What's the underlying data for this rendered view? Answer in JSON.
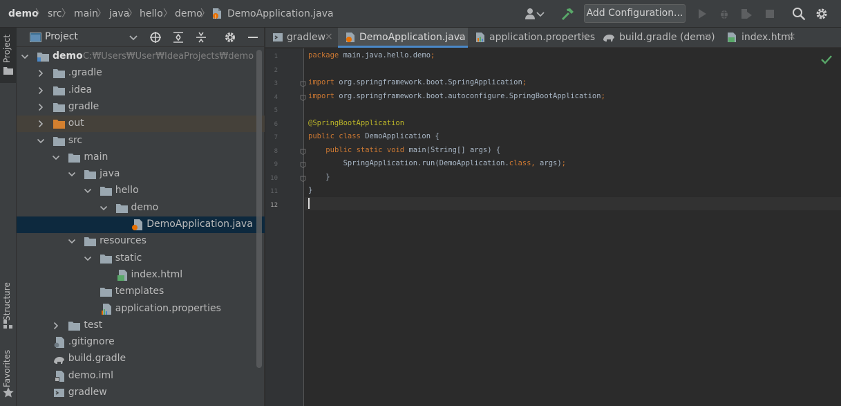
{
  "breadcrumb": {
    "items": [
      "demo",
      "src",
      "main",
      "java",
      "hello",
      "demo",
      "DemoApplication.java"
    ],
    "sep": "〉"
  },
  "toolbar": {
    "add_config_label": "Add Configuration...",
    "icons": [
      "user-icon",
      "chevron-down-icon",
      "hammer-icon",
      "run-icon",
      "debug-icon",
      "coverage-icon",
      "stop-icon",
      "search-icon",
      "gear-icon"
    ]
  },
  "left_stripe": {
    "project_label": "Project",
    "structure_label": "Structure",
    "favorites_label": "Favorites"
  },
  "project_panel": {
    "title": "Project",
    "tree": [
      {
        "label": "demo",
        "path": "C:\\Users\\User\\IdeaProjects\\demo",
        "depth": 0,
        "type": "module-folder",
        "expanded": true
      },
      {
        "label": ".gradle",
        "depth": 1,
        "type": "folder",
        "expanded": false
      },
      {
        "label": ".idea",
        "depth": 1,
        "type": "folder",
        "expanded": false
      },
      {
        "label": "gradle",
        "depth": 1,
        "type": "folder",
        "expanded": false
      },
      {
        "label": "out",
        "depth": 1,
        "type": "excluded-folder",
        "expanded": false
      },
      {
        "label": "src",
        "depth": 1,
        "type": "folder",
        "expanded": true
      },
      {
        "label": "main",
        "depth": 2,
        "type": "folder",
        "expanded": true
      },
      {
        "label": "java",
        "depth": 3,
        "type": "source-folder",
        "expanded": true
      },
      {
        "label": "hello",
        "depth": 4,
        "type": "package",
        "expanded": true
      },
      {
        "label": "demo",
        "depth": 5,
        "type": "package",
        "expanded": true
      },
      {
        "label": "DemoApplication.java",
        "depth": 6,
        "type": "java-file",
        "selected": true
      },
      {
        "label": "resources",
        "depth": 3,
        "type": "resources-folder",
        "expanded": true
      },
      {
        "label": "static",
        "depth": 4,
        "type": "folder",
        "expanded": true
      },
      {
        "label": "index.html",
        "depth": 5,
        "type": "html-file"
      },
      {
        "label": "templates",
        "depth": 4,
        "type": "folder"
      },
      {
        "label": "application.properties",
        "depth": 4,
        "type": "properties-file"
      },
      {
        "label": "test",
        "depth": 2,
        "type": "folder",
        "expanded": false
      },
      {
        "label": ".gitignore",
        "depth": 1,
        "type": "text-file"
      },
      {
        "label": "build.gradle",
        "depth": 1,
        "type": "gradle-file"
      },
      {
        "label": "demo.iml",
        "depth": 1,
        "type": "iml-file"
      },
      {
        "label": "gradlew",
        "depth": 1,
        "type": "script-file"
      }
    ]
  },
  "editor": {
    "tabs": [
      {
        "label": "gradlew",
        "icon": "script-file-icon",
        "active": false
      },
      {
        "label": "DemoApplication.java",
        "icon": "java-file-icon",
        "active": true
      },
      {
        "label": "application.properties",
        "icon": "properties-file-icon",
        "active": false
      },
      {
        "label": "build.gradle (demo)",
        "icon": "gradle-elephant-icon",
        "active": false
      },
      {
        "label": "index.html",
        "icon": "html-file-icon",
        "active": false
      }
    ],
    "close_glyph": "×",
    "current_line": 12,
    "lines": [
      "package main.java.hello.demo;",
      "",
      "import org.springframework.boot.SpringApplication;",
      "import org.springframework.boot.autoconfigure.SpringBootApplication;",
      "",
      "@SpringBootApplication",
      "public class DemoApplication {",
      "    public static void main(String[] args) {",
      "        SpringApplication.run(DemoApplication.class, args);",
      "    }",
      "}",
      ""
    ]
  },
  "colors": {
    "bg": "#2b2b2b",
    "panel": "#3c3f41",
    "keyword": "#cc7832",
    "annotation": "#bbb529",
    "plain": "#a9b7c6",
    "selection": "#0d293e",
    "active_tab_underline": "#4a88c7",
    "check_green": "#59a869"
  }
}
